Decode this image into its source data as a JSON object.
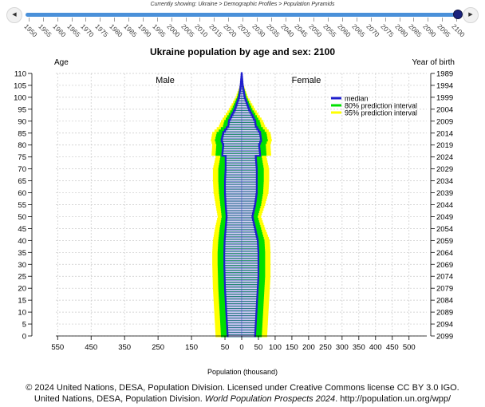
{
  "breadcrumb": "Currently showing: Ukraine > Demographic Profiles > Population Pyramids",
  "nav": {
    "prev_icon": "triangle-left",
    "next_icon": "triangle-right"
  },
  "slider": {
    "years": [
      "1950",
      "1955",
      "1960",
      "1965",
      "1970",
      "1975",
      "1980",
      "1985",
      "1990",
      "1995",
      "2000",
      "2005",
      "2010",
      "2015",
      "2020",
      "2025",
      "2030",
      "2035",
      "2040",
      "2045",
      "2050",
      "2055",
      "2060",
      "2065",
      "2070",
      "2075",
      "2080",
      "2085",
      "2090",
      "2095",
      "2100"
    ],
    "selected": "2100",
    "track_color": "#4a90d9",
    "handle_color": "#1a237e"
  },
  "chart_data": {
    "type": "area",
    "title": "Ukraine population by age and sex: 2100",
    "left_axis_label": "Age",
    "right_axis_label": "Year of birth",
    "xlabel": "Population (thousand)",
    "xlim": [
      -550,
      550
    ],
    "ylim": [
      0,
      110
    ],
    "x_ticks": [
      -550,
      -450,
      -350,
      -250,
      -150,
      -50,
      0,
      50,
      100,
      150,
      200,
      250,
      300,
      350,
      400,
      450,
      500
    ],
    "x_tick_labels": [
      "550",
      "450",
      "350",
      "250",
      "150",
      "50",
      "0",
      "50",
      "100",
      "150",
      "200",
      "250",
      "300",
      "350",
      "400",
      "450",
      "500"
    ],
    "y_ticks": [
      0,
      5,
      10,
      15,
      20,
      25,
      30,
      35,
      40,
      45,
      50,
      55,
      60,
      65,
      70,
      75,
      80,
      85,
      90,
      95,
      100,
      105,
      110
    ],
    "y_tick_labels": [
      "0",
      "5",
      "10",
      "15",
      "20",
      "25",
      "30",
      "35",
      "40",
      "45",
      "50",
      "55",
      "60",
      "65",
      "70",
      "75",
      "80",
      "85",
      "90",
      "95",
      "100",
      "105",
      "110"
    ],
    "right_tick_labels": [
      "2099",
      "2094",
      "2089",
      "2084",
      "2079",
      "2074",
      "2069",
      "2064",
      "2059",
      "2054",
      "2049",
      "2044",
      "2039",
      "2034",
      "2029",
      "2024",
      "2019",
      "2014",
      "2009",
      "2004",
      "1999",
      "1994",
      "1989"
    ],
    "sex_labels": {
      "male": "Male",
      "female": "Female"
    },
    "legend": {
      "placement": "top-right",
      "entries": [
        {
          "label": "median",
          "color": "#1f1fcc"
        },
        {
          "label": "80% prediction interval",
          "color": "#00e000"
        },
        {
          "label": "95% prediction interval",
          "color": "#ffff00"
        }
      ]
    },
    "grid": true,
    "colors": {
      "median": "#1f1fcc",
      "pi80": "#00e000",
      "pi95": "#ffff00",
      "bar_fill": "#cfcff0"
    },
    "ages": [
      0,
      5,
      10,
      15,
      20,
      25,
      30,
      35,
      40,
      45,
      50,
      55,
      60,
      65,
      70,
      75,
      76,
      80,
      82,
      85,
      88,
      90,
      95,
      100,
      105,
      110
    ],
    "series": [
      {
        "name": "median",
        "male": [
          42,
          44,
          46,
          48,
          50,
          51,
          52,
          52,
          51,
          48,
          45,
          48,
          50,
          50,
          48,
          48,
          58,
          55,
          60,
          55,
          40,
          38,
          20,
          8,
          3,
          0
        ],
        "female": [
          40,
          42,
          44,
          46,
          48,
          50,
          50,
          50,
          48,
          40,
          32,
          40,
          45,
          45,
          45,
          42,
          55,
          52,
          58,
          55,
          42,
          40,
          22,
          9,
          3,
          0
        ]
      },
      {
        "name": "80% prediction interval",
        "male_low": [
          32,
          34,
          36,
          38,
          40,
          41,
          42,
          43,
          43,
          41,
          38,
          40,
          42,
          42,
          42,
          42,
          50,
          48,
          52,
          48,
          34,
          32,
          16,
          6,
          2,
          0
        ],
        "male_high": [
          62,
          64,
          66,
          68,
          70,
          71,
          72,
          72,
          70,
          66,
          60,
          64,
          68,
          70,
          70,
          64,
          78,
          76,
          80,
          75,
          56,
          52,
          30,
          14,
          4,
          0
        ],
        "female_low": [
          30,
          32,
          34,
          36,
          38,
          40,
          40,
          41,
          40,
          34,
          26,
          33,
          38,
          38,
          38,
          36,
          47,
          45,
          50,
          48,
          36,
          34,
          18,
          7,
          2,
          0
        ],
        "female_high": [
          60,
          62,
          64,
          66,
          68,
          70,
          70,
          70,
          68,
          58,
          48,
          58,
          64,
          66,
          66,
          60,
          74,
          72,
          78,
          74,
          58,
          54,
          32,
          15,
          5,
          0
        ]
      },
      {
        "name": "95% prediction interval",
        "male_high": [
          78,
          80,
          82,
          84,
          86,
          87,
          88,
          88,
          86,
          80,
          72,
          78,
          84,
          86,
          86,
          78,
          90,
          88,
          92,
          88,
          68,
          62,
          38,
          18,
          5,
          0
        ],
        "female_high": [
          76,
          78,
          80,
          82,
          84,
          86,
          86,
          86,
          84,
          70,
          58,
          70,
          80,
          82,
          82,
          74,
          88,
          86,
          90,
          86,
          70,
          64,
          40,
          19,
          6,
          0
        ]
      }
    ]
  },
  "caption": {
    "line1": "© 2024 United Nations, DESA, Population Division. Licensed under Creative Commons license CC BY 3.0 IGO.",
    "line2_prefix": "United Nations, DESA, Population Division. ",
    "line2_italic": "World Population Prospects 2024",
    "line2_suffix": ". http://population.un.org/wpp/"
  }
}
